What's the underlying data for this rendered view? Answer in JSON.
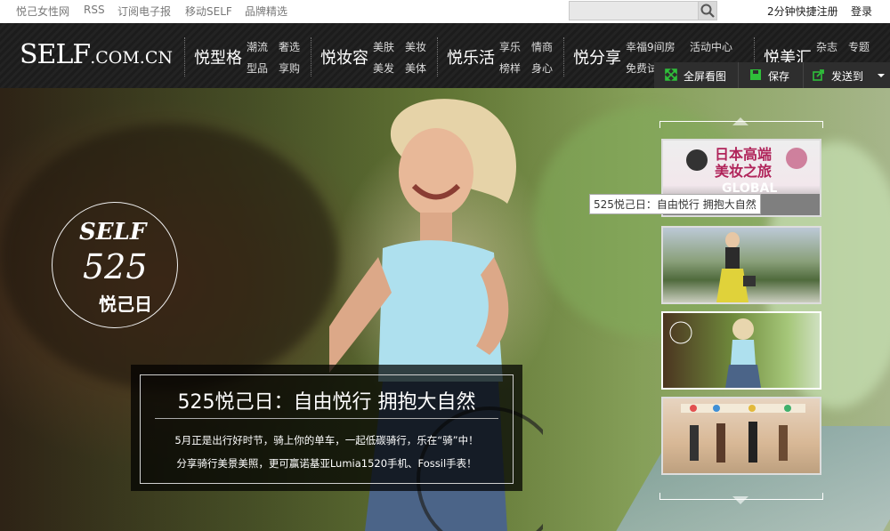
{
  "topbar": {
    "links": [
      "悦己女性网",
      "RSS",
      "订阅电子报",
      "移动SELF",
      "品牌精选"
    ],
    "search_placeholder": "",
    "register": "2分钟快捷注册",
    "login": "登录"
  },
  "nav": {
    "logo": {
      "main": "SELF",
      "suffix": ".COM.CN"
    },
    "sections": [
      {
        "title": "悦型格",
        "subs": [
          "潮流",
          "奢选",
          "型品",
          "享购"
        ]
      },
      {
        "title": "悦妆容",
        "subs": [
          "美肤",
          "美妆",
          "美发",
          "美体"
        ]
      },
      {
        "title": "悦乐活",
        "subs": [
          "享乐",
          "情商",
          "榜样",
          "身心"
        ]
      },
      {
        "title": "悦分享",
        "subs": [
          "幸福9间房",
          "活动中心",
          "免费试"
        ]
      },
      {
        "title": "悦美汇",
        "subs": [
          "杂志",
          "专题"
        ]
      }
    ]
  },
  "stamp": {
    "line1": "SELF",
    "line2": "525",
    "line3": "悦己日"
  },
  "caption": {
    "title": "525悦己日：自由悦行 拥抱大自然",
    "line1": "5月正是出行好时节，骑上你的单车，一起低碳骑行，乐在“骑”中！",
    "line2": "分享骑行美景美照，更可赢诺基亚Lumia1520手机、Fossil手表！"
  },
  "toolbar": {
    "fullscreen": "全屏看图",
    "save": "保存",
    "sendto": "发送到"
  },
  "thumbs": {
    "tooltip": "525悦己日：自由悦行 拥抱大自然",
    "first_text": "日本高端 美妆之旅",
    "first_sub": "GLOBAL"
  },
  "colors": {
    "accent_green": "#2fbf3a",
    "nav_bg": "#1f1f1f"
  }
}
